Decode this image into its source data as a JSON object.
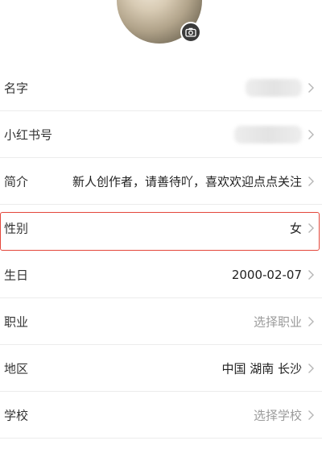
{
  "profile": {
    "avatar_icon": "avatar-photo",
    "camera_icon": "camera-icon"
  },
  "fields": [
    {
      "key": "name",
      "label": "名字",
      "value": "",
      "value_hidden": true
    },
    {
      "key": "xhs_id",
      "label": "小红书号",
      "value": "",
      "value_hidden": true
    },
    {
      "key": "bio",
      "label": "简介",
      "value": "新人创作者，请善待吖，喜欢欢迎点点关注"
    },
    {
      "key": "gender",
      "label": "性别",
      "value": "女",
      "highlighted": true
    },
    {
      "key": "birthday",
      "label": "生日",
      "value": "2000-02-07"
    },
    {
      "key": "occupation",
      "label": "职业",
      "value": "选择职业",
      "placeholder": true
    },
    {
      "key": "region",
      "label": "地区",
      "value": "中国 湖南 长沙"
    },
    {
      "key": "school",
      "label": "学校",
      "value": "选择学校",
      "placeholder": true
    }
  ],
  "colors": {
    "highlight_border": "#e4473b",
    "placeholder_text": "#9b9b9b",
    "divider": "#ececec"
  }
}
